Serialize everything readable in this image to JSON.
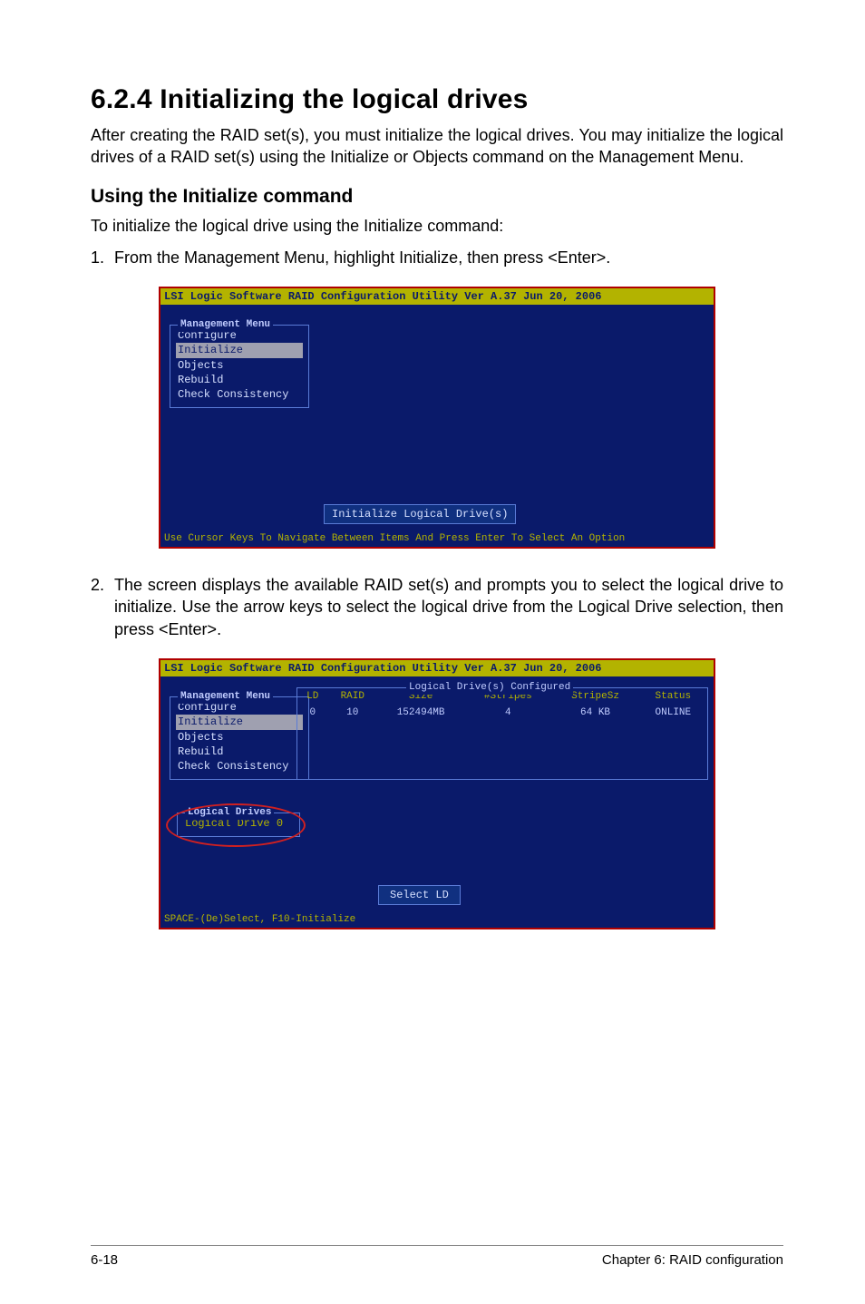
{
  "section": {
    "number_title": "6.2.4 Initializing the logical drives",
    "intro": "After creating the RAID set(s), you must initialize the logical drives. You may initialize the logical drives of a RAID set(s) using the Initialize or Objects command on the Management Menu.",
    "subheading": "Using the Initialize command",
    "instr": "To initialize the logical drive using the Initialize command:",
    "step1": "From the Management Menu, highlight Initialize, then press <Enter>.",
    "step2": "The screen displays the available RAID set(s) and prompts you to select the logical drive to initialize. Use the arrow keys to select the logical drive from the Logical Drive selection, then press <Enter>."
  },
  "bios1": {
    "title": "LSI Logic Software RAID Configuration Utility Ver A.37 Jun 20, 2006",
    "menu_legend": "Management Menu",
    "items": [
      "Configure",
      "Initialize",
      "Objects",
      "Rebuild",
      "Check Consistency"
    ],
    "highlight_index": 1,
    "hint": "Initialize Logical Drive(s)",
    "footer": "Use Cursor Keys To Navigate Between Items And Press Enter To Select An Option"
  },
  "bios2": {
    "title": "LSI Logic Software RAID Configuration Utility Ver A.37 Jun 20, 2006",
    "menu_legend": "Management Menu",
    "items": [
      "Configure",
      "Initialize",
      "Objects",
      "Rebuild",
      "Check Consistency"
    ],
    "highlight_index": 1,
    "table_legend": "Logical Drive(s) Configured",
    "headers": [
      "LD",
      "RAID",
      "Size",
      "#Stripes",
      "StripeSz",
      "Status"
    ],
    "row": {
      "ld": "0",
      "raid": "10",
      "size": "152494MB",
      "stripes": "4",
      "stripesz": "64  KB",
      "status": "ONLINE"
    },
    "ld_panel_legend": "Logical Drives",
    "ld_panel_item": "Logical Drive 0",
    "select_hint": "Select LD",
    "footer": "SPACE-(De)Select,  F10-Initialize"
  },
  "footer": {
    "left": "6-18",
    "right": "Chapter 6: RAID configuration"
  }
}
